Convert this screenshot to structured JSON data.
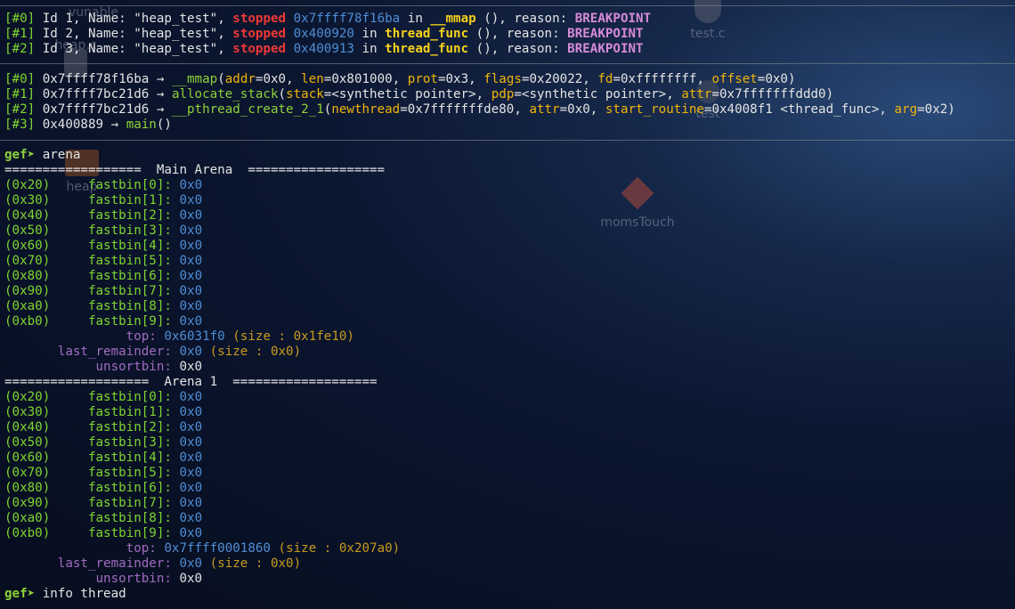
{
  "desktop": {
    "icons": [
      {
        "label": "vunable"
      },
      {
        "label": "test.c"
      },
      {
        "label": "heap.c"
      },
      {
        "label": "test"
      },
      {
        "label": "heap"
      },
      {
        "label": "momsTouch"
      }
    ]
  },
  "threads": [
    {
      "tid": "[#0]",
      "id": "Id 1",
      "name": "\"heap_test\"",
      "state": "stopped",
      "addr": "0x7ffff78f16ba",
      "func": "__mmap",
      "reason": "BREAKPOINT"
    },
    {
      "tid": "[#1]",
      "id": "Id 2",
      "name": "\"heap_test\"",
      "state": "stopped",
      "addr": "0x400920",
      "func": "thread_func",
      "reason": "BREAKPOINT"
    },
    {
      "tid": "[#2]",
      "id": "Id 3",
      "name": "\"heap_test\"",
      "state": "stopped",
      "addr": "0x400913",
      "func": "thread_func",
      "reason": "BREAKPOINT"
    }
  ],
  "trace": [
    {
      "idx": "[#0]",
      "addr": "0x7ffff78f16ba",
      "func": "__mmap",
      "args": [
        [
          "addr",
          "0x0"
        ],
        [
          "len",
          "0x801000"
        ],
        [
          "prot",
          "0x3"
        ],
        [
          "flags",
          "0x20022"
        ],
        [
          "fd",
          "0xffffffff"
        ],
        [
          "offset",
          "0x0"
        ]
      ]
    },
    {
      "idx": "[#1]",
      "addr": "0x7ffff7bc21d6",
      "func": "allocate_stack",
      "args": [
        [
          "stack",
          "<synthetic pointer>"
        ],
        [
          "pdp",
          "<synthetic pointer>"
        ],
        [
          "attr",
          "0x7fffffffddd0"
        ]
      ]
    },
    {
      "idx": "[#2]",
      "addr": "0x7ffff7bc21d6",
      "func": "__pthread_create_2_1",
      "args": [
        [
          "newthread",
          "0x7fffffffde80"
        ],
        [
          "attr",
          "0x0"
        ],
        [
          "start_routine",
          "0x4008f1 <thread_func>"
        ],
        [
          "arg",
          "0x2"
        ]
      ]
    },
    {
      "idx": "[#3]",
      "addr": "0x400889",
      "func": "main",
      "args": []
    }
  ],
  "prompt": "gef➤",
  "commands": {
    "first": "arena",
    "last": "info thread"
  },
  "arenas": [
    {
      "header": "==================  Main Arena  ==================",
      "fastbins": [
        {
          "size": "(0x20)",
          "name": "fastbin[0]:",
          "val": "0x0"
        },
        {
          "size": "(0x30)",
          "name": "fastbin[1]:",
          "val": "0x0"
        },
        {
          "size": "(0x40)",
          "name": "fastbin[2]:",
          "val": "0x0"
        },
        {
          "size": "(0x50)",
          "name": "fastbin[3]:",
          "val": "0x0"
        },
        {
          "size": "(0x60)",
          "name": "fastbin[4]:",
          "val": "0x0"
        },
        {
          "size": "(0x70)",
          "name": "fastbin[5]:",
          "val": "0x0"
        },
        {
          "size": "(0x80)",
          "name": "fastbin[6]:",
          "val": "0x0"
        },
        {
          "size": "(0x90)",
          "name": "fastbin[7]:",
          "val": "0x0"
        },
        {
          "size": "(0xa0)",
          "name": "fastbin[8]:",
          "val": "0x0"
        },
        {
          "size": "(0xb0)",
          "name": "fastbin[9]:",
          "val": "0x0"
        }
      ],
      "top": {
        "label": "top:",
        "addr": "0x6031f0",
        "size": "(size : 0x1fe10)"
      },
      "last_remainder": {
        "label": "last_remainder:",
        "addr": "0x0",
        "size": "(size : 0x0)"
      },
      "unsortbin": {
        "label": "unsortbin:",
        "val": "0x0"
      }
    },
    {
      "header": "===================  Arena 1  ===================",
      "fastbins": [
        {
          "size": "(0x20)",
          "name": "fastbin[0]:",
          "val": "0x0"
        },
        {
          "size": "(0x30)",
          "name": "fastbin[1]:",
          "val": "0x0"
        },
        {
          "size": "(0x40)",
          "name": "fastbin[2]:",
          "val": "0x0"
        },
        {
          "size": "(0x50)",
          "name": "fastbin[3]:",
          "val": "0x0"
        },
        {
          "size": "(0x60)",
          "name": "fastbin[4]:",
          "val": "0x0"
        },
        {
          "size": "(0x70)",
          "name": "fastbin[5]:",
          "val": "0x0"
        },
        {
          "size": "(0x80)",
          "name": "fastbin[6]:",
          "val": "0x0"
        },
        {
          "size": "(0x90)",
          "name": "fastbin[7]:",
          "val": "0x0"
        },
        {
          "size": "(0xa0)",
          "name": "fastbin[8]:",
          "val": "0x0"
        },
        {
          "size": "(0xb0)",
          "name": "fastbin[9]:",
          "val": "0x0"
        }
      ],
      "top": {
        "label": "top:",
        "addr": "0x7ffff0001860",
        "size": "(size : 0x207a0)"
      },
      "last_remainder": {
        "label": "last_remainder:",
        "addr": "0x0",
        "size": "(size : 0x0)"
      },
      "unsortbin": {
        "label": "unsortbin:",
        "val": "0x0"
      }
    }
  ]
}
